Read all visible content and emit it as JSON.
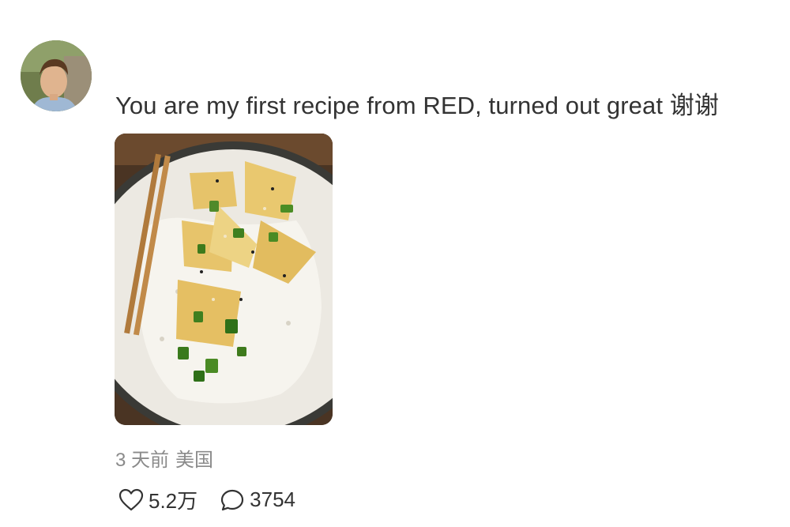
{
  "comment": {
    "avatar_icon": "user-avatar",
    "text": "You are my first recipe from RED, turned out great 谢谢",
    "photo_icon": "food-photo-tofu-rice",
    "meta": {
      "time": "3 天前",
      "location": "美国"
    },
    "actions": {
      "like_icon": "heart-icon",
      "like_count": "5.2万",
      "reply_icon": "comment-bubble-icon",
      "reply_count": "3754"
    }
  }
}
